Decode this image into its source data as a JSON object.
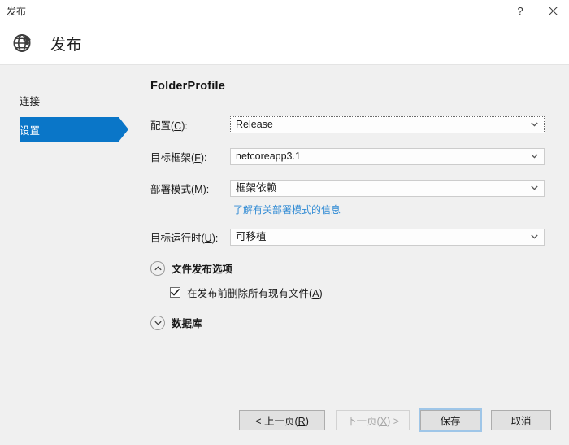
{
  "window": {
    "title": "发布",
    "help_icon": "question-mark-icon",
    "close_icon": "close-icon"
  },
  "header": {
    "icon": "globe-publish-icon",
    "title": "发布"
  },
  "sidebar": {
    "items": [
      {
        "label": "连接",
        "selected": false
      },
      {
        "label": "设置",
        "selected": true
      }
    ]
  },
  "main": {
    "profile_title": "FolderProfile",
    "fields": [
      {
        "label_prefix": "配置(",
        "label_key": "C",
        "label_suffix": "):",
        "value": "Release",
        "focused": true
      },
      {
        "label_prefix": "目标框架(",
        "label_key": "F",
        "label_suffix": "):",
        "value": "netcoreapp3.1",
        "focused": false
      },
      {
        "label_prefix": "部署模式(",
        "label_key": "M",
        "label_suffix": "):",
        "value": "框架依赖",
        "focused": false
      },
      {
        "label_prefix": "目标运行时(",
        "label_key": "U",
        "label_suffix": "):",
        "value": "可移植",
        "focused": false
      }
    ],
    "deployment_link": "了解有关部署模式的信息",
    "sections": [
      {
        "title": "文件发布选项",
        "expanded": true,
        "chevron": "chevron-up-icon",
        "checkbox": {
          "checked": true,
          "label_prefix": "在发布前删除所有现有文件(",
          "label_key": "A",
          "label_suffix": ")"
        }
      },
      {
        "title": "数据库",
        "expanded": false,
        "chevron": "chevron-down-icon"
      }
    ]
  },
  "footer": {
    "buttons": [
      {
        "prefix": "< 上一页(",
        "key": "R",
        "suffix": ")",
        "disabled": false,
        "focused": false
      },
      {
        "prefix": "下一页(",
        "key": "X",
        "suffix": ") >",
        "disabled": true,
        "focused": false
      },
      {
        "prefix": "保存",
        "key": "",
        "suffix": "",
        "disabled": false,
        "focused": true
      },
      {
        "prefix": "取消",
        "key": "",
        "suffix": "",
        "disabled": false,
        "focused": false
      }
    ]
  },
  "colors": {
    "accent": "#0a76c8",
    "link": "#2f8ad4",
    "body_bg": "#f0f0f0",
    "header_bg": "#ffffff"
  }
}
